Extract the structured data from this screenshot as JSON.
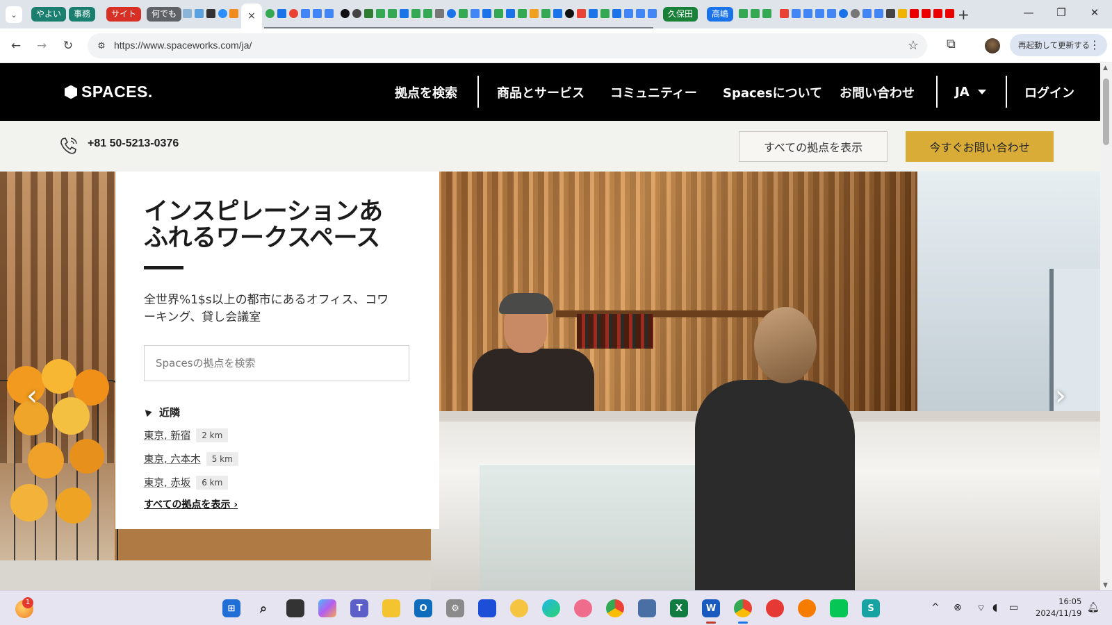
{
  "browser": {
    "tab_groups": [
      {
        "label": "やよい",
        "color": "#1a7f6e"
      },
      {
        "label": "事務",
        "color": "#1a7f6e"
      },
      {
        "label": "サイト",
        "color": "#d93025"
      },
      {
        "label": "何でも",
        "color": "#5f6368"
      },
      {
        "label": "久保田",
        "color": "#188038"
      },
      {
        "label": "高嶋",
        "color": "#1a73e8"
      }
    ],
    "active_tab_close": "×",
    "new_tab": "+",
    "url": "https://www.spaceworks.com/ja/",
    "relaunch_label": "再起動して更新する"
  },
  "site": {
    "logo": "SPACES.",
    "nav": {
      "search_locations": "拠点を検索",
      "products": "商品とサービス",
      "community": "コミュニティー",
      "about": "Spacesについて",
      "contact": "お問い合わせ",
      "language": "JA",
      "login": "ログイン"
    },
    "phone": "+81 50-5213-0376",
    "show_all_button": "すべての拠点を表示",
    "contact_now_button": "今すぐお問い合わせ"
  },
  "hero": {
    "title_line1": "インスピレーションあ",
    "title_line2": "ふれるワークスペース",
    "subtitle_line1": "全世界%1$s以上の都市にあるオフィス、コワ",
    "subtitle_line2": "ーキング、貸し会議室",
    "search_placeholder": "Spacesの拠点を検索",
    "nearby_label": "近隣",
    "locations": [
      {
        "name": "東京, 新宿",
        "distance": "2 km"
      },
      {
        "name": "東京, 六本木",
        "distance": "5 km"
      },
      {
        "name": "東京, 赤坂",
        "distance": "6 km"
      }
    ],
    "view_all_link": "すべての拠点を表示 ›",
    "prev_arrow": "‹",
    "next_arrow": "›"
  },
  "taskbar": {
    "weather_badge": "1",
    "clock_time": "16:05",
    "clock_date": "2024/11/19"
  },
  "colors": {
    "accent_gold": "#d8ac37",
    "header_black": "#000000"
  }
}
